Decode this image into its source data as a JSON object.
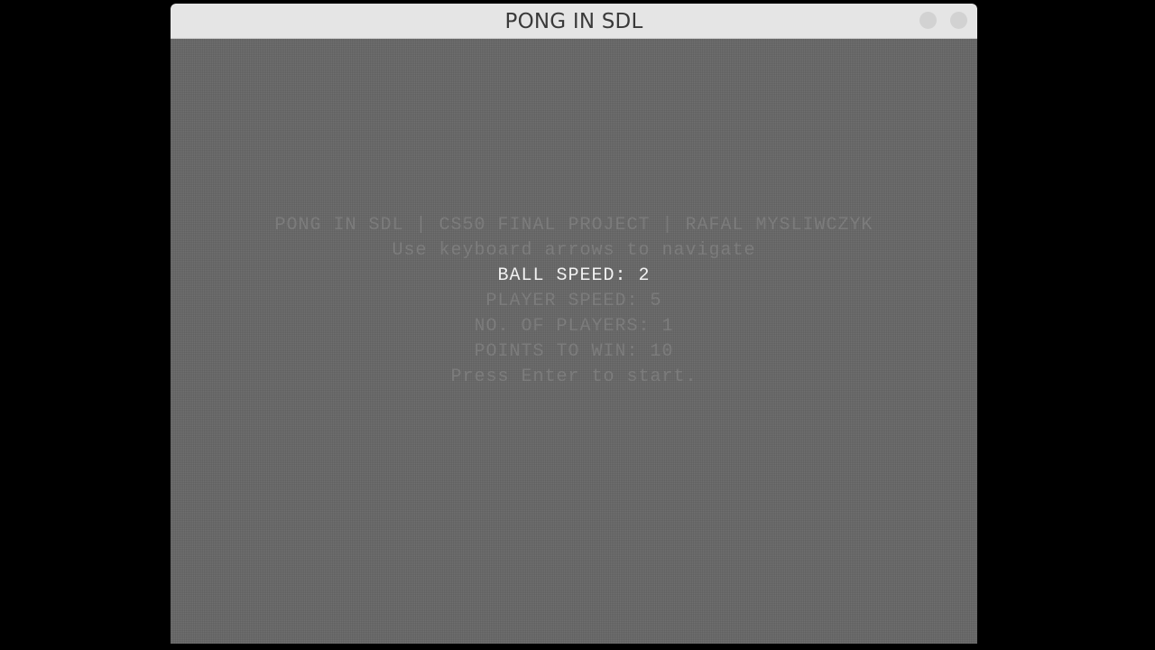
{
  "window": {
    "title": "PONG IN SDL"
  },
  "menu": {
    "header": "PONG IN SDL | CS50 FINAL PROJECT | RAFAL MYSLIWCZYK",
    "hint": "Use keyboard arrows to navigate",
    "ball_speed": "BALL SPEED: 2",
    "player_speed": "PLAYER SPEED: 5",
    "players": "NO. OF PLAYERS: 1",
    "points_to_win": "POINTS TO WIN: 10",
    "start": "Press Enter to start.",
    "selected_item": "BALL SPEED"
  },
  "colors": {
    "background": "#000000",
    "game_area": "#676767",
    "titlebar": "#e5e5e5",
    "dim_text": "#7c7c7c",
    "selected_text": "#f2f2f2"
  }
}
